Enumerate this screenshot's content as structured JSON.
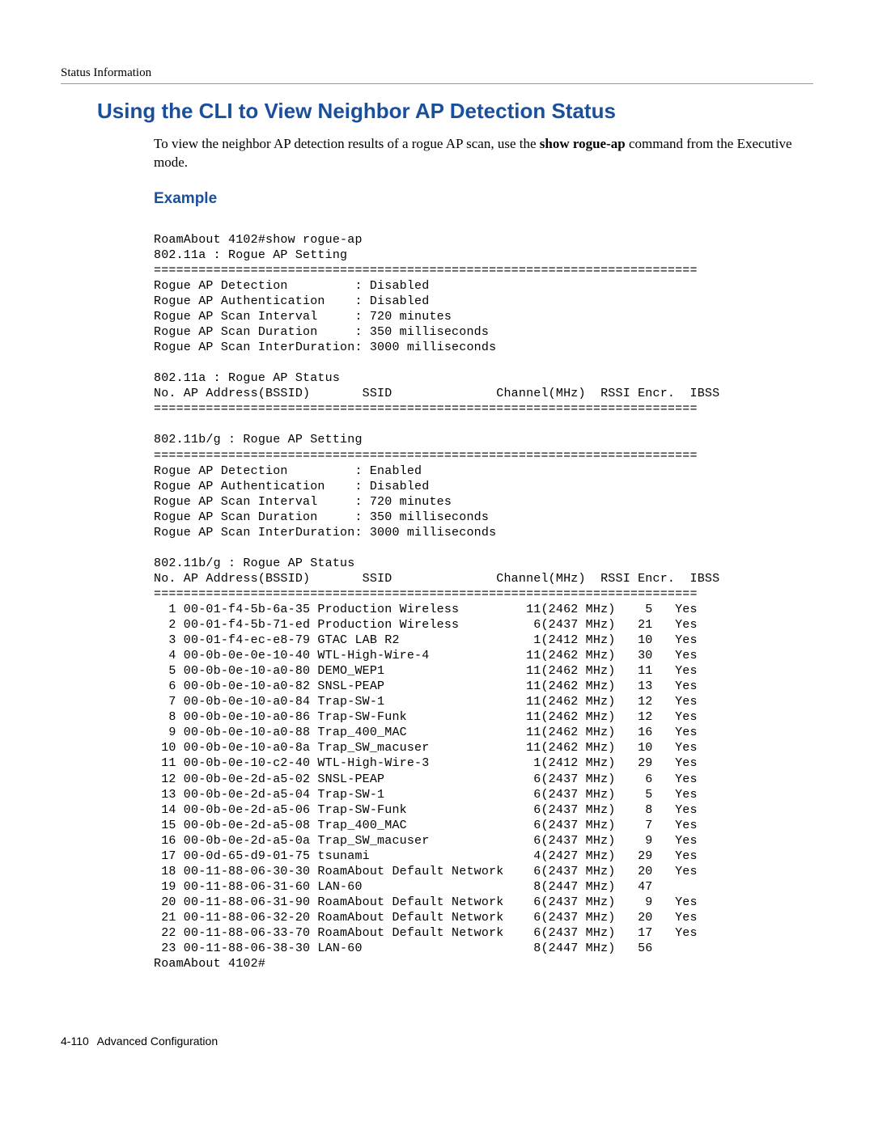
{
  "header": {
    "running_head": "Status Information"
  },
  "section": {
    "title": "Using the CLI to View Neighbor AP Detection Status",
    "intro_pre": "To view the neighbor AP detection results of a rogue AP scan, use the ",
    "intro_cmd": "show rogue-ap",
    "intro_post": " command from the Executive mode.",
    "example_label": "Example"
  },
  "cli": {
    "prompt_with_command": "RoamAbout 4102#show rogue-ap",
    "section_a_title": "802.11a : Rogue AP Setting",
    "hr": "=========================================================================",
    "settings_a": [
      "Rogue AP Detection         : Disabled",
      "Rogue AP Authentication    : Disabled",
      "Rogue AP Scan Interval     : 720 minutes",
      "Rogue AP Scan Duration     : 350 milliseconds",
      "Rogue AP Scan InterDuration: 3000 milliseconds"
    ],
    "status_a_title": "802.11a : Rogue AP Status",
    "status_header": "No. AP Address(BSSID)       SSID              Channel(MHz)  RSSI Encr.  IBSS",
    "section_bg_title": "802.11b/g : Rogue AP Setting",
    "settings_bg": [
      "Rogue AP Detection         : Enabled",
      "Rogue AP Authentication    : Disabled",
      "Rogue AP Scan Interval     : 720 minutes",
      "Rogue AP Scan Duration     : 350 milliseconds",
      "Rogue AP Scan InterDuration: 3000 milliseconds"
    ],
    "status_bg_title": "802.11b/g : Rogue AP Status",
    "rows": [
      "  1 00-01-f4-5b-6a-35 Production Wireless         11(2462 MHz)    5   Yes",
      "  2 00-01-f4-5b-71-ed Production Wireless          6(2437 MHz)   21   Yes",
      "  3 00-01-f4-ec-e8-79 GTAC LAB R2                  1(2412 MHz)   10   Yes",
      "  4 00-0b-0e-0e-10-40 WTL-High-Wire-4             11(2462 MHz)   30   Yes",
      "  5 00-0b-0e-10-a0-80 DEMO_WEP1                   11(2462 MHz)   11   Yes",
      "  6 00-0b-0e-10-a0-82 SNSL-PEAP                   11(2462 MHz)   13   Yes",
      "  7 00-0b-0e-10-a0-84 Trap-SW-1                   11(2462 MHz)   12   Yes",
      "  8 00-0b-0e-10-a0-86 Trap-SW-Funk                11(2462 MHz)   12   Yes",
      "  9 00-0b-0e-10-a0-88 Trap_400_MAC                11(2462 MHz)   16   Yes",
      " 10 00-0b-0e-10-a0-8a Trap_SW_macuser             11(2462 MHz)   10   Yes",
      " 11 00-0b-0e-10-c2-40 WTL-High-Wire-3              1(2412 MHz)   29   Yes",
      " 12 00-0b-0e-2d-a5-02 SNSL-PEAP                    6(2437 MHz)    6   Yes",
      " 13 00-0b-0e-2d-a5-04 Trap-SW-1                    6(2437 MHz)    5   Yes",
      " 14 00-0b-0e-2d-a5-06 Trap-SW-Funk                 6(2437 MHz)    8   Yes",
      " 15 00-0b-0e-2d-a5-08 Trap_400_MAC                 6(2437 MHz)    7   Yes",
      " 16 00-0b-0e-2d-a5-0a Trap_SW_macuser              6(2437 MHz)    9   Yes",
      " 17 00-0d-65-d9-01-75 tsunami                      4(2427 MHz)   29   Yes",
      " 18 00-11-88-06-30-30 RoamAbout Default Network    6(2437 MHz)   20   Yes",
      " 19 00-11-88-06-31-60 LAN-60                       8(2447 MHz)   47",
      " 20 00-11-88-06-31-90 RoamAbout Default Network    6(2437 MHz)    9   Yes",
      " 21 00-11-88-06-32-20 RoamAbout Default Network    6(2437 MHz)   20   Yes",
      " 22 00-11-88-06-33-70 RoamAbout Default Network    6(2437 MHz)   17   Yes",
      " 23 00-11-88-06-38-30 LAN-60                       8(2447 MHz)   56"
    ],
    "final_prompt": "RoamAbout 4102#"
  },
  "footer": {
    "page_number": "4-110",
    "page_label": "Advanced Configuration"
  }
}
